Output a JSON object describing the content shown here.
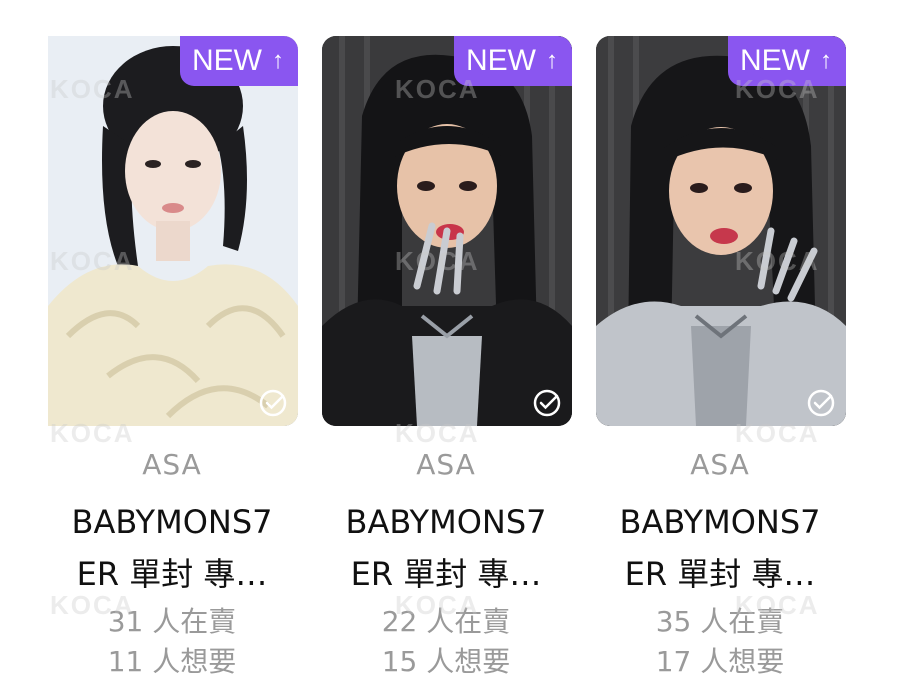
{
  "cards": [
    {
      "badge": "NEW",
      "badge_arrow": "↑",
      "member": "ASA",
      "title_line1": "BABYMONS7",
      "title_line2": "ER 單封 專…",
      "sellers": "31 人在賣",
      "wanters": "11 人想要",
      "photo_style": "light"
    },
    {
      "badge": "NEW",
      "badge_arrow": "↑",
      "member": "ASA",
      "title_line1": "BABYMONS7",
      "title_line2": "ER 單封 專…",
      "sellers": "22 人在賣",
      "wanters": "15 人想要",
      "photo_style": "dark"
    },
    {
      "badge": "NEW",
      "badge_arrow": "↑",
      "member": "ASA",
      "title_line1": "BABYMONS7",
      "title_line2": "ER 單封 專…",
      "sellers": "35 人在賣",
      "wanters": "17 人想要",
      "photo_style": "dark"
    }
  ],
  "watermark": "KOCA",
  "colors": {
    "badge": "#8a56f0",
    "muted_text": "#9a9a9a",
    "title_text": "#111111"
  },
  "icons": {
    "badge_arrow": "arrow-up-icon",
    "check": "check-circle-icon"
  }
}
